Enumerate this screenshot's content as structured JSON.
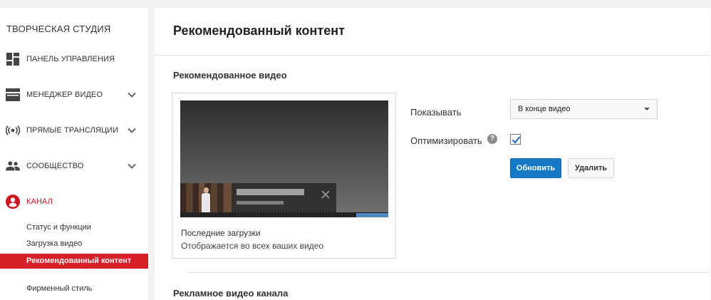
{
  "sidebar": {
    "studio_title": "ТВОРЧЕСКАЯ СТУДИЯ",
    "items": [
      {
        "label": "ПАНЕЛЬ УПРАВЛЕНИЯ",
        "icon": "dashboard-icon"
      },
      {
        "label": "МЕНЕДЖЕР ВИДЕО",
        "icon": "video-manager-icon"
      },
      {
        "label": "ПРЯМЫЕ ТРАНСЛЯЦИИ",
        "icon": "live-broadcast-icon"
      },
      {
        "label": "СООБЩЕСТВО",
        "icon": "community-icon"
      },
      {
        "label": "КАНАЛ",
        "icon": "channel-icon"
      }
    ],
    "channel_subitems": [
      {
        "label": "Статус и функции"
      },
      {
        "label": "Загрузка видео"
      },
      {
        "label": "Рекомендованный контент"
      },
      {
        "label": "Фирменный стиль"
      }
    ],
    "active_color": "#cc181e"
  },
  "main": {
    "page_title": "Рекомендованный контент",
    "featured_section_title": "Рекомендованное видео",
    "card": {
      "title": "Последние загрузки",
      "subtitle": "Отображается во всех ваших видео"
    },
    "form": {
      "show_label": "Показывать",
      "show_value": "В конце видео",
      "optimize_label": "Оптимизировать",
      "help_glyph": "?",
      "optimize_checked": true,
      "update_button": "Обновить",
      "delete_button": "Удалить"
    },
    "promo_section_title": "Рекламное видео канала"
  },
  "colors": {
    "accent_blue": "#167ac6",
    "channel_red": "#d61f26"
  }
}
